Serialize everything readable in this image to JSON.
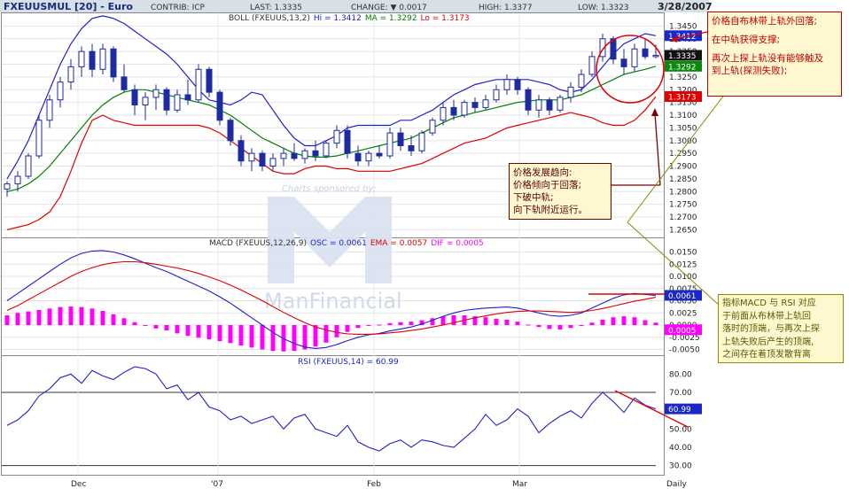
{
  "header": {
    "symbol": "FXEUUSMUL [20] - Euro",
    "contrib": "CONTRIB: ICP",
    "last": "LAST: 1.3335",
    "change": "CHANGE: ▼ 0.0017",
    "high": "HIGH: 1.3377",
    "low": "LOW: 1.3323",
    "date": "3/28/2007"
  },
  "colors": {
    "header_bg": "#d7dfe9",
    "up_candle": "#ffffff",
    "down_candle": "#1e2aa0",
    "boll_upper": "#2020d0",
    "boll_mid": "#008000",
    "boll_lower": "#e00000",
    "macd_osc": "#2020d0",
    "macd_ema": "#e00000",
    "macd_hist": "#ff00ff",
    "rsi": "#2020d0",
    "annotation_red": "#e00000",
    "annotation_dark": "#7a0000",
    "annotation_olive": "#8a8a00",
    "watermark": "#dbe3f1"
  },
  "watermark": {
    "sponsor": "Charts sponsored by:",
    "brand": "ManFinancial"
  },
  "panels": {
    "boll": {
      "label_prefix": "BOLL (FXEUUS,13,2)",
      "hi": "Hi = 1.3412",
      "ma": "MA = 1.3292",
      "lo": "Lo = 1.3173"
    },
    "macd": {
      "label_prefix": "MACD (FXEUUS,12,26,9)",
      "osc": "OSC = 0.0061",
      "ema": "EMA = 0.0057",
      "dif": "DIF = 0.0005"
    },
    "rsi": {
      "label": "RSI (FXEUUS,14) = 60.99"
    }
  },
  "price_ticks": [
    "1.3450",
    "1.3400",
    "1.3350",
    "1.3300",
    "1.3250",
    "1.3200",
    "1.3150",
    "1.3100",
    "1.3050",
    "1.3000",
    "1.2950",
    "1.2900",
    "1.2850",
    "1.2800",
    "1.2750",
    "1.2700",
    "1.2650"
  ],
  "price_badges": [
    "1.3412",
    "1.3335",
    "1.3292",
    "1.3173"
  ],
  "macd_ticks": [
    "0.0150",
    "0.0125",
    "0.0100",
    "0.0075",
    "0.0050",
    "0.0025",
    "0.0000",
    "-0.0025",
    "-0.0050"
  ],
  "macd_badges": [
    "0.0061",
    "0.0005"
  ],
  "rsi_ticks": [
    "80.00",
    "70.00",
    "60.00",
    "50.00",
    "40.00",
    "30.00"
  ],
  "rsi_badge": "60.99",
  "x_ticks": [
    "Dec",
    "'07",
    "Feb",
    "Mar",
    "Daily"
  ],
  "annotations": {
    "note1": [
      "价格自布林带上轨外回落;",
      "在中轨获得支撑;",
      "再次上探上轨没有能够触及",
      "到上轨(探测失败);"
    ],
    "note2": [
      "价格发展趋向:",
      "价格倾向于回落;",
      "下破中轨;",
      "向下轨附近运行。"
    ],
    "note3": [
      "指标MACD 与 RSI 对应",
      "于前面从布林带上轨回",
      "落时的顶端，与再次上探",
      "上轨失败后产生的顶端,",
      "之间存在着顶发散背离"
    ]
  },
  "chart_data": [
    {
      "type": "candlestick",
      "title": "BOLL (FXEUUS,13,2)",
      "ylim": [
        1.262,
        1.35
      ],
      "x_labels": [
        "Dec",
        "'07",
        "Feb",
        "Mar"
      ],
      "series": [
        {
          "name": "Hi",
          "values": [
            1.285,
            1.292,
            1.3,
            1.31,
            1.32,
            1.33,
            1.338,
            1.344,
            1.348,
            1.349,
            1.348,
            1.346,
            1.343,
            1.34,
            1.337,
            1.334,
            1.33,
            1.325,
            1.32,
            1.316,
            1.315,
            1.314,
            1.316,
            1.319,
            1.318,
            1.312,
            1.306,
            1.301,
            1.298,
            1.298,
            1.3,
            1.302,
            1.305,
            1.306,
            1.306,
            1.306,
            1.306,
            1.308,
            1.308,
            1.31,
            1.312,
            1.315,
            1.318,
            1.32,
            1.322,
            1.323,
            1.324,
            1.324,
            1.324,
            1.324,
            1.323,
            1.322,
            1.32,
            1.319,
            1.32,
            1.324,
            1.329,
            1.334,
            1.338,
            1.34,
            1.342,
            1.3412
          ]
        },
        {
          "name": "MA",
          "values": [
            1.28,
            1.281,
            1.283,
            1.286,
            1.29,
            1.295,
            1.3,
            1.305,
            1.31,
            1.314,
            1.317,
            1.319,
            1.32,
            1.32,
            1.319,
            1.318,
            1.317,
            1.316,
            1.315,
            1.314,
            1.312,
            1.31,
            1.307,
            1.304,
            1.301,
            1.299,
            1.297,
            1.295,
            1.294,
            1.2935,
            1.2935,
            1.294,
            1.295,
            1.296,
            1.297,
            1.298,
            1.299,
            1.3,
            1.301,
            1.303,
            1.305,
            1.307,
            1.309,
            1.31,
            1.311,
            1.312,
            1.313,
            1.314,
            1.315,
            1.3155,
            1.316,
            1.316,
            1.316,
            1.317,
            1.318,
            1.32,
            1.322,
            1.324,
            1.326,
            1.327,
            1.328,
            1.3292
          ]
        },
        {
          "name": "Lo",
          "values": [
            1.265,
            1.266,
            1.267,
            1.269,
            1.272,
            1.278,
            1.288,
            1.299,
            1.308,
            1.31,
            1.308,
            1.307,
            1.306,
            1.306,
            1.306,
            1.306,
            1.306,
            1.306,
            1.306,
            1.305,
            1.303,
            1.3,
            1.297,
            1.294,
            1.291,
            1.288,
            1.287,
            1.287,
            1.289,
            1.29,
            1.29,
            1.289,
            1.289,
            1.288,
            1.288,
            1.288,
            1.288,
            1.289,
            1.29,
            1.291,
            1.293,
            1.295,
            1.297,
            1.299,
            1.3,
            1.301,
            1.303,
            1.305,
            1.306,
            1.307,
            1.308,
            1.309,
            1.31,
            1.311,
            1.31,
            1.309,
            1.307,
            1.306,
            1.306,
            1.308,
            1.312,
            1.3173
          ]
        }
      ],
      "ohlc": [
        [
          1.281,
          1.284,
          1.278,
          1.283
        ],
        [
          1.283,
          1.288,
          1.28,
          1.286
        ],
        [
          1.286,
          1.295,
          1.285,
          1.294
        ],
        [
          1.294,
          1.31,
          1.293,
          1.308
        ],
        [
          1.308,
          1.318,
          1.305,
          1.316
        ],
        [
          1.316,
          1.325,
          1.313,
          1.323
        ],
        [
          1.323,
          1.332,
          1.32,
          1.329
        ],
        [
          1.329,
          1.337,
          1.325,
          1.335
        ],
        [
          1.335,
          1.338,
          1.325,
          1.328
        ],
        [
          1.328,
          1.338,
          1.326,
          1.336
        ],
        [
          1.336,
          1.337,
          1.323,
          1.325
        ],
        [
          1.325,
          1.33,
          1.319,
          1.32
        ],
        [
          1.32,
          1.322,
          1.31,
          1.314
        ],
        [
          1.314,
          1.319,
          1.308,
          1.317
        ],
        [
          1.317,
          1.322,
          1.312,
          1.32
        ],
        [
          1.32,
          1.321,
          1.31,
          1.312
        ],
        [
          1.312,
          1.32,
          1.311,
          1.318
        ],
        [
          1.318,
          1.324,
          1.314,
          1.316
        ],
        [
          1.316,
          1.33,
          1.315,
          1.328
        ],
        [
          1.328,
          1.329,
          1.317,
          1.319
        ],
        [
          1.319,
          1.32,
          1.306,
          1.308
        ],
        [
          1.308,
          1.309,
          1.298,
          1.3
        ],
        [
          1.3,
          1.302,
          1.29,
          1.292
        ],
        [
          1.292,
          1.297,
          1.288,
          1.295
        ],
        [
          1.295,
          1.296,
          1.288,
          1.29
        ],
        [
          1.29,
          1.295,
          1.288,
          1.293
        ],
        [
          1.293,
          1.297,
          1.29,
          1.295
        ],
        [
          1.295,
          1.299,
          1.292,
          1.293
        ],
        [
          1.293,
          1.297,
          1.291,
          1.296
        ],
        [
          1.296,
          1.3,
          1.292,
          1.294
        ],
        [
          1.294,
          1.3,
          1.293,
          1.299
        ],
        [
          1.299,
          1.306,
          1.297,
          1.304
        ],
        [
          1.304,
          1.306,
          1.293,
          1.295
        ],
        [
          1.295,
          1.298,
          1.29,
          1.292
        ],
        [
          1.292,
          1.296,
          1.29,
          1.295
        ],
        [
          1.295,
          1.298,
          1.293,
          1.294
        ],
        [
          1.294,
          1.305,
          1.293,
          1.303
        ],
        [
          1.303,
          1.305,
          1.296,
          1.298
        ],
        [
          1.298,
          1.302,
          1.294,
          1.296
        ],
        [
          1.296,
          1.304,
          1.295,
          1.303
        ],
        [
          1.303,
          1.309,
          1.302,
          1.308
        ],
        [
          1.308,
          1.315,
          1.306,
          1.313
        ],
        [
          1.313,
          1.316,
          1.308,
          1.31
        ],
        [
          1.31,
          1.316,
          1.309,
          1.315
        ],
        [
          1.315,
          1.317,
          1.311,
          1.313
        ],
        [
          1.313,
          1.318,
          1.312,
          1.316
        ],
        [
          1.316,
          1.322,
          1.315,
          1.32
        ],
        [
          1.32,
          1.326,
          1.318,
          1.324
        ],
        [
          1.324,
          1.325,
          1.318,
          1.32
        ],
        [
          1.32,
          1.321,
          1.31,
          1.312
        ],
        [
          1.312,
          1.318,
          1.309,
          1.316
        ],
        [
          1.316,
          1.317,
          1.31,
          1.312
        ],
        [
          1.312,
          1.318,
          1.311,
          1.317
        ],
        [
          1.317,
          1.323,
          1.315,
          1.321
        ],
        [
          1.321,
          1.328,
          1.319,
          1.326
        ],
        [
          1.326,
          1.335,
          1.325,
          1.333
        ],
        [
          1.333,
          1.342,
          1.331,
          1.34
        ],
        [
          1.34,
          1.341,
          1.33,
          1.332
        ],
        [
          1.332,
          1.336,
          1.326,
          1.329
        ],
        [
          1.329,
          1.338,
          1.327,
          1.336
        ],
        [
          1.336,
          1.34,
          1.332,
          1.333
        ],
        [
          1.333,
          1.3377,
          1.3323,
          1.3335
        ]
      ]
    },
    {
      "type": "line",
      "title": "MACD (FXEUUS,12,26,9)",
      "ylim": [
        -0.006,
        0.016
      ],
      "series": [
        {
          "name": "OSC",
          "values": [
            0.005,
            0.0065,
            0.008,
            0.0095,
            0.011,
            0.0125,
            0.0138,
            0.0147,
            0.0152,
            0.0153,
            0.015,
            0.0144,
            0.0136,
            0.0127,
            0.0118,
            0.011,
            0.01,
            0.009,
            0.008,
            0.007,
            0.0058,
            0.0045,
            0.003,
            0.0015,
            0.0,
            -0.0015,
            -0.0028,
            -0.0038,
            -0.0045,
            -0.0048,
            -0.0046,
            -0.004,
            -0.0032,
            -0.0025,
            -0.002,
            -0.0017,
            -0.0012,
            -0.0008,
            -0.0004,
            0.0002,
            0.001,
            0.0018,
            0.0025,
            0.003,
            0.0033,
            0.0035,
            0.0036,
            0.0037,
            0.0035,
            0.003,
            0.0025,
            0.002,
            0.0018,
            0.002,
            0.0025,
            0.0035,
            0.0045,
            0.0055,
            0.0062,
            0.0065,
            0.0063,
            0.0061
          ]
        },
        {
          "name": "EMA",
          "values": [
            0.003,
            0.004,
            0.0052,
            0.0064,
            0.0076,
            0.0088,
            0.01,
            0.011,
            0.0118,
            0.0124,
            0.0128,
            0.013,
            0.013,
            0.0128,
            0.0125,
            0.0121,
            0.0117,
            0.0112,
            0.0106,
            0.0099,
            0.0091,
            0.0082,
            0.0072,
            0.0061,
            0.005,
            0.0038,
            0.0026,
            0.0015,
            0.0005,
            -0.0004,
            -0.001,
            -0.0015,
            -0.0018,
            -0.0019,
            -0.0019,
            -0.0018,
            -0.0016,
            -0.0014,
            -0.0011,
            -0.0008,
            -0.0004,
            0.0,
            0.0005,
            0.001,
            0.0015,
            0.0019,
            0.0023,
            0.0026,
            0.0028,
            0.0029,
            0.0029,
            0.0028,
            0.0027,
            0.0026,
            0.0027,
            0.003,
            0.0034,
            0.0039,
            0.0044,
            0.0049,
            0.0053,
            0.0057
          ]
        },
        {
          "name": "DIF",
          "values": [
            0.002,
            0.0025,
            0.0028,
            0.0031,
            0.0034,
            0.0037,
            0.0038,
            0.0037,
            0.0034,
            0.0029,
            0.0022,
            0.0014,
            0.0006,
            -0.0001,
            -0.0007,
            -0.0011,
            -0.0017,
            -0.0022,
            -0.0026,
            -0.0029,
            -0.0033,
            -0.0037,
            -0.0042,
            -0.0046,
            -0.005,
            -0.0053,
            -0.0054,
            -0.0053,
            -0.005,
            -0.0044,
            -0.0036,
            -0.0025,
            -0.0014,
            -0.0006,
            -0.0001,
            0.0001,
            0.0004,
            0.0006,
            0.0007,
            0.001,
            0.0014,
            0.0018,
            0.002,
            0.002,
            0.0018,
            0.0016,
            0.0013,
            0.0011,
            0.0007,
            0.0001,
            -0.0004,
            -0.0008,
            -0.0009,
            -0.0006,
            -0.0002,
            0.0005,
            0.0011,
            0.0016,
            0.0018,
            0.0016,
            0.001,
            0.0005
          ]
        }
      ]
    },
    {
      "type": "line",
      "title": "RSI (FXEUUS,14)",
      "ylim": [
        25,
        85
      ],
      "reference_lines": [
        70,
        30
      ],
      "series": [
        {
          "name": "RSI",
          "values": [
            52,
            55,
            60,
            68,
            72,
            78,
            80,
            75,
            82,
            79,
            77,
            81,
            84,
            83,
            80,
            72,
            74,
            66,
            70,
            62,
            60,
            55,
            57,
            53,
            55,
            57,
            50,
            56,
            58,
            50,
            48,
            46,
            52,
            43,
            40,
            38,
            42,
            44,
            40,
            44,
            43,
            41,
            40,
            45,
            50,
            58,
            52,
            55,
            61,
            57,
            48,
            53,
            57,
            60,
            56,
            64,
            70,
            65,
            59,
            67,
            63,
            61
          ]
        }
      ]
    }
  ]
}
